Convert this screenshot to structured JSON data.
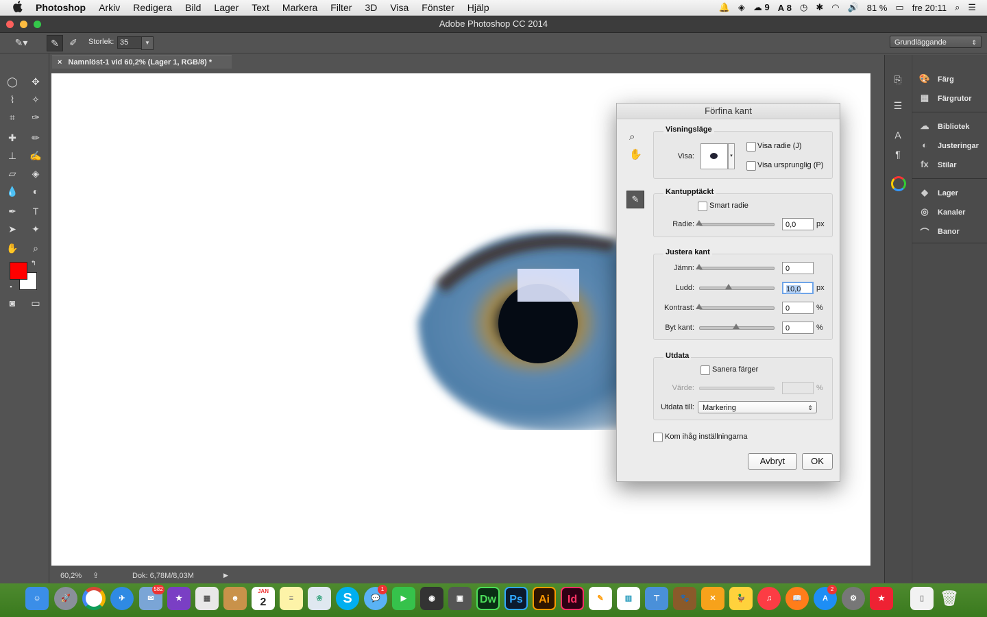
{
  "menubar": {
    "app": "Photoshop",
    "items": [
      "Arkiv",
      "Redigera",
      "Bild",
      "Lager",
      "Text",
      "Markera",
      "Filter",
      "3D",
      "Visa",
      "Fönster",
      "Hjälp"
    ],
    "status": {
      "cc_count": "9",
      "ai_count": "8",
      "battery": "81 %",
      "clock": "fre 20:11"
    }
  },
  "window": {
    "title": "Adobe Photoshop CC 2014"
  },
  "options": {
    "size_label": "Storlek:",
    "size_value": "35",
    "workspace": "Grundläggande"
  },
  "document": {
    "tab_title": "Namnlöst-1 vid 60,2% (Lager 1, RGB/8) *",
    "zoom": "60,2%",
    "doc_info": "Dok: 6,78M/8,03M"
  },
  "colors": {
    "foreground": "#ff0000",
    "background": "#ffffff",
    "accent": "#3b82d9"
  },
  "panels": {
    "group1": [
      "Färg",
      "Färgrutor"
    ],
    "group2": [
      "Bibliotek",
      "Justeringar",
      "Stilar"
    ],
    "group3": [
      "Lager",
      "Kanaler",
      "Banor"
    ]
  },
  "dialog": {
    "title": "Förfina kant",
    "view_mode": {
      "title": "Visningsläge",
      "view_label": "Visa:",
      "show_radius": "Visa radie (J)",
      "show_original": "Visa ursprunglig (P)"
    },
    "edge_detection": {
      "title": "Kantupptäckt",
      "smart_radius": "Smart radie",
      "radius_label": "Radie:",
      "radius_value": "0,0",
      "radius_unit": "px",
      "radius_fraction": 0.0
    },
    "adjust_edge": {
      "title": "Justera kant",
      "smooth": {
        "label": "Jämn:",
        "value": "0",
        "fraction": 0.0
      },
      "feather": {
        "label": "Ludd:",
        "value": "10,0",
        "unit": "px",
        "fraction": 0.4
      },
      "contrast": {
        "label": "Kontrast:",
        "value": "0",
        "unit": "%",
        "fraction": 0.0
      },
      "shift_edge": {
        "label": "Byt kant:",
        "value": "0",
        "unit": "%",
        "fraction": 0.5
      }
    },
    "output": {
      "title": "Utdata",
      "decontaminate": "Sanera färger",
      "amount_label": "Värde:",
      "amount_unit": "%",
      "output_to_label": "Utdata till:",
      "output_to_value": "Markering"
    },
    "remember": "Kom ihåg inställningarna",
    "cancel": "Avbryt",
    "ok": "OK"
  },
  "dock": {
    "badges": {
      "mail": "582",
      "messages": "1",
      "appstore": "2"
    },
    "calendar_month": "JAN",
    "calendar_day": "2",
    "dw": "Dw",
    "ps": "Ps",
    "ai": "Ai",
    "id": "Id"
  }
}
